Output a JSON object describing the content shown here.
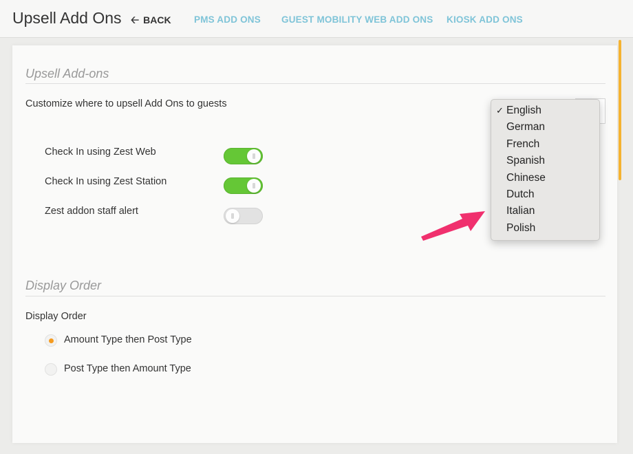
{
  "header": {
    "title": "Upsell Add Ons",
    "back_label": "BACK",
    "nav": [
      "PMS ADD ONS",
      "GUEST MOBILITY WEB ADD ONS",
      "KIOSK ADD ONS"
    ]
  },
  "upsell": {
    "section_title": "Upsell Add-ons",
    "description": "Customize where to upsell Add Ons to guests",
    "toggles": [
      {
        "label": "Check In using Zest Web",
        "on": true
      },
      {
        "label": "Check In using Zest Station",
        "on": true
      },
      {
        "label": "Zest addon staff alert",
        "on": false
      }
    ]
  },
  "language_dropdown": {
    "selected": "English",
    "options": [
      "English",
      "German",
      "French",
      "Spanish",
      "Chinese",
      "Dutch",
      "Italian",
      "Polish"
    ],
    "check_mark": "✓"
  },
  "display_order": {
    "section_title": "Display Order",
    "label": "Display Order",
    "options": [
      {
        "label": "Amount Type then Post Type",
        "checked": true
      },
      {
        "label": "Post Type then Amount Type",
        "checked": false
      }
    ]
  },
  "colors": {
    "accent_nav": "#7fc4d8",
    "toggle_on": "#65c736",
    "radio_selected": "#f59b20",
    "annotation_arrow": "#f0306e",
    "scrollbar": "#f5b331"
  },
  "icons": {
    "back": "arrow-left-icon",
    "annotation": "pointer-arrow-icon"
  }
}
